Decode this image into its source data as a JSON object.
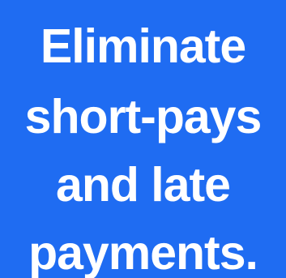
{
  "headline": {
    "lines": [
      "Eliminate",
      "short-pays",
      "and late",
      "payments."
    ]
  },
  "colors": {
    "background": "#1f6cf2",
    "text": "#ffffff"
  }
}
